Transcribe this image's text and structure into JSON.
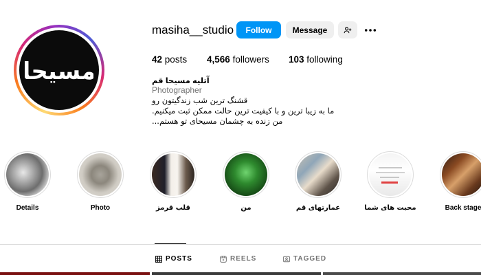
{
  "profile": {
    "username": "masiha__studio",
    "avatar_text": "مسیحا",
    "follow_label": "Follow",
    "message_label": "Message",
    "add_user_icon": "person-add-icon",
    "more_icon": "more-horizontal-icon"
  },
  "stats": {
    "posts_count": "42",
    "posts_label": "posts",
    "followers_count": "4,566",
    "followers_label": "followers",
    "following_count": "103",
    "following_label": "following"
  },
  "bio": {
    "name": "آتلیه مسیحا قم",
    "category": "Photographer",
    "line1": "قشنگ ترین شب زندگیتون رو",
    "line2": "ما به زیبا ترین و با کیفیت ترین حالت ممکن ثبت میکنیم.",
    "line3": "من زنده به چشمان مسیحای تو هستم..."
  },
  "highlights": [
    {
      "label": "Details"
    },
    {
      "label": "Photo"
    },
    {
      "label": "قلب قرمز"
    },
    {
      "label": "من"
    },
    {
      "label": "عمارتهای قم"
    },
    {
      "label": "محبت های شما"
    },
    {
      "label": "Back stage"
    }
  ],
  "tabs": {
    "posts": "POSTS",
    "reels": "REELS",
    "tagged": "TAGGED"
  },
  "colors": {
    "follow_button": "#0095f6",
    "secondary_button": "#efefef",
    "muted_text": "#737373"
  }
}
